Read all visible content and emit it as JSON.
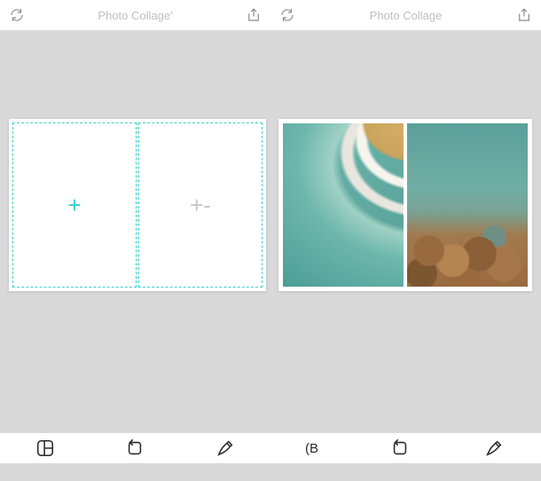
{
  "header": {
    "left_title": "Photo Collage'",
    "right_title": "Photo Collage",
    "refresh_icon": "refresh",
    "share_icon": "share"
  },
  "editor": {
    "left_panel": {
      "cell1_symbol": "+",
      "cell2_symbol": "+-"
    }
  },
  "toolbar": {
    "left": {
      "layout": "layout",
      "rotate": "rotate",
      "edit": "edit"
    },
    "right": {
      "label": "(B",
      "rotate": "rotate",
      "edit": "edit"
    }
  }
}
